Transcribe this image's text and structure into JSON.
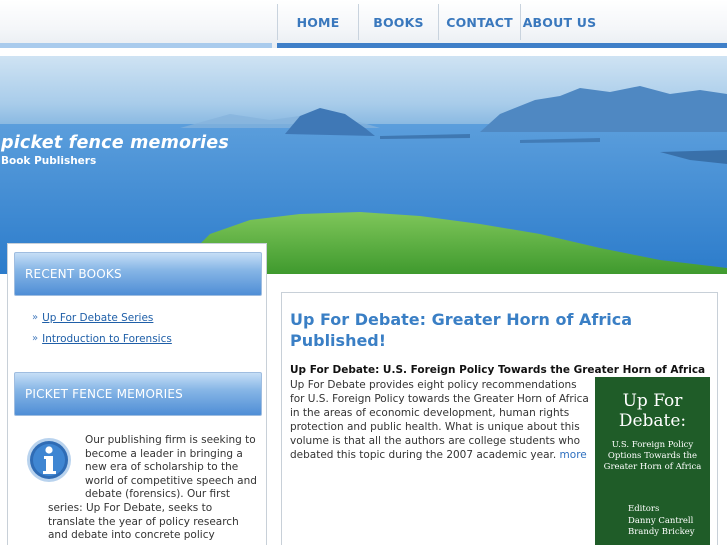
{
  "nav": {
    "home": "HOME",
    "books": "BOOKS",
    "contact": "CONTACT",
    "about": "ABOUT US"
  },
  "header": {
    "title": "picket fence memories",
    "subtitle": "Book Publishers"
  },
  "sidebar": {
    "recent_heading": "RECENT BOOKS",
    "recent_books": [
      {
        "label": "Up For Debate Series"
      },
      {
        "label": "Introduction to Forensics"
      }
    ],
    "about_heading": "PICKET FENCE MEMORIES",
    "about_icon": "info-icon",
    "about_text": "Our publishing firm is seeking to become a leader in bringing a new era of scholarship to the world of competitive speech and debate (forensics). Our first series: Up For Debate, seeks to translate the year of policy research and debate into concrete policy"
  },
  "article": {
    "title": "Up For Debate: Greater Horn of Africa Published!",
    "subheading": "Up For Debate: U.S. Foreign Policy Towards the Greater Horn of Africa",
    "body": "Up For Debate provides eight policy recommendations for U.S. Foreign Policy towards the Greater Horn of Africa in the areas of economic development, human rights protection and public health. What is unique about this volume is that all the authors are college students who debated this topic during the 2007 academic year.",
    "more_link": "more",
    "cover": {
      "title": "Up For Debate:",
      "subtitle": "U.S. Foreign Policy Options Towards the Greater Horn of Africa",
      "editor_label": "Editors",
      "authors": [
        "Danny Cantrell",
        "Brandy Brickey"
      ]
    }
  },
  "colors": {
    "accent": "#3a7fc5",
    "nav_text": "#3a78bd",
    "sidebar_header": "#4f8ed6",
    "cover_green": "#1f5c28"
  }
}
